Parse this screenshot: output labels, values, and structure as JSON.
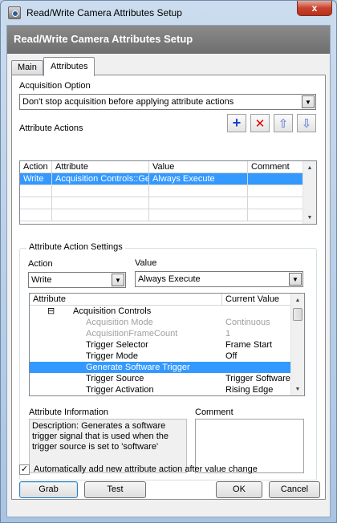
{
  "window": {
    "title": "Read/Write Camera Attributes Setup",
    "close_glyph": "x"
  },
  "header": {
    "title": "Read/Write Camera Attributes Setup"
  },
  "tabs": [
    {
      "label": "Main"
    },
    {
      "label": "Attributes"
    }
  ],
  "acquisition_option": {
    "label": "Acquisition Option",
    "value": "Don't stop acquisition before applying attribute actions"
  },
  "attribute_actions": {
    "label": "Attribute Actions",
    "toolbar": {
      "add": "+",
      "delete": "✕",
      "up": "⇧",
      "down": "⇩"
    },
    "columns": [
      "Action",
      "Attribute",
      "Value",
      "Comment"
    ],
    "rows": [
      {
        "action": "Write",
        "attribute": "Acquisition Controls::Ge",
        "value": "Always Execute",
        "comment": ""
      }
    ]
  },
  "settings": {
    "group_label": "Attribute Action Settings",
    "action_label": "Action",
    "action_value": "Write",
    "value_label": "Value",
    "value_value": "Always Execute",
    "tree_columns": [
      "Attribute",
      "Current Value"
    ],
    "tree_rows": [
      {
        "expander": "⊟",
        "name": "Acquisition Controls",
        "value": ""
      },
      {
        "name": "Acquisition Mode",
        "value": "Continuous",
        "muted": true
      },
      {
        "name": "AcquisitionFrameCount",
        "value": "1",
        "muted": true
      },
      {
        "name": "Trigger Selector",
        "value": "Frame Start"
      },
      {
        "name": "Trigger Mode",
        "value": "Off"
      },
      {
        "name": "Generate Software Trigger",
        "value": "",
        "selected": true
      },
      {
        "name": "Trigger Source",
        "value": "Trigger Software"
      },
      {
        "name": "Trigger Activation",
        "value": "Rising Edge"
      }
    ],
    "info_label": "Attribute Information",
    "info_text": "Description: Generates a software trigger signal that is used when the trigger source is set to 'software'",
    "comment_label": "Comment",
    "comment_value": ""
  },
  "auto_add": {
    "checked": true,
    "check_glyph": "✓",
    "label": "Automatically add new attribute action after value change"
  },
  "buttons": {
    "grab": "Grab",
    "test": "Test",
    "ok": "OK",
    "cancel": "Cancel"
  },
  "colors": {
    "selection": "#3399ff",
    "header_band": "#777777",
    "close_button": "#c7432d"
  }
}
